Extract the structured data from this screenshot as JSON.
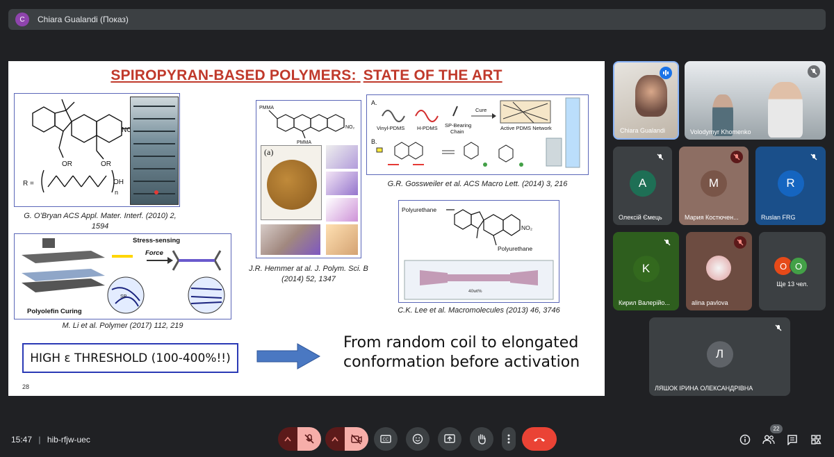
{
  "presenter": {
    "avatar_letter": "C",
    "label": "Chiara Gualandi (Показ)"
  },
  "slide": {
    "title_part1": "SPIROPYRAN-BASED POLYMERS:",
    "title_part2": "STATE OF THE ART",
    "page_number": "28",
    "captions": {
      "obryan_1": "G. O’Bryan ACS Appl. Mater. Interf. (2010) 2,",
      "obryan_2": "1594",
      "hemmer_1": "J.R. Hemmer at al. J. Polym. Sci. B",
      "hemmer_2": "(2014) 52, 1347",
      "gossweiler": "G.R. Gossweiler et al. ACS Macro Lett. (2014) 3, 216",
      "lee": "C.K. Lee et al. Macromolecules (2013) 46, 3746",
      "li": "M. Li et al. Polymer (2017) 112, 219"
    },
    "figure_labels": {
      "no2": "NO₂",
      "or1": "OR",
      "or2": "OR",
      "r_eq": "R =",
      "oh": "OH",
      "n": "n",
      "pmma_top": "PMMA",
      "pmma_bottom": "PMMA",
      "panel_a": "(a)",
      "a_label": "A.",
      "b_label": "B.",
      "vinyl_pdms": "Vinyl-PDMS",
      "h_pdms": "H-PDMS",
      "sp_bearing": "SP-Bearing",
      "chain": "Chain",
      "cure": "Cure",
      "active_pdms": "Active PDMS Network",
      "polyurethane_top": "Polyurethane",
      "polyurethane_bottom": "Polyurethane",
      "wt": "40wt%",
      "stress_sensing": "Stress-sensing",
      "force": "Force",
      "polyolefin_curing": "Polyolefin Curing",
      "sp": "SP"
    },
    "high_threshold": "HIGH ε THRESHOLD (100-400%!!)",
    "conclusion_line1": "From random coil to elongated",
    "conclusion_line2": "conformation before activation"
  },
  "participants": [
    {
      "name": "Chiara Gualandi",
      "speaking": true
    },
    {
      "name": "Volodymyr Khomenko"
    },
    {
      "name": "Олексій Ємець",
      "initial": "A",
      "color": "#1e6f55"
    },
    {
      "name": "Мария Костючен...",
      "initial": "M",
      "color": "#8d6e63"
    },
    {
      "name": "Ruslan FRG",
      "initial": "R",
      "color": "#1565c0"
    },
    {
      "name": "Кирил Валерійо...",
      "initial": "K",
      "color": "#33691e"
    },
    {
      "name": "alina pavlova"
    },
    {
      "name": "Ще 13 чел.",
      "initial_a": "O",
      "initial_b": "O"
    },
    {
      "name": "ЛЯШОК ІРИНА ОЛЕКСАНДРІВНА",
      "initial": "Л",
      "color": "#5f6368"
    }
  ],
  "bottom_bar": {
    "time": "15:47",
    "separator": "|",
    "meeting_code": "hib-rfjw-uec",
    "participant_count": "22"
  },
  "colors": {
    "accent_red": "#c0392b",
    "end_call": "#ea4335",
    "dark_red": "#5c1a1a",
    "tile_bg": "#3c4043"
  }
}
